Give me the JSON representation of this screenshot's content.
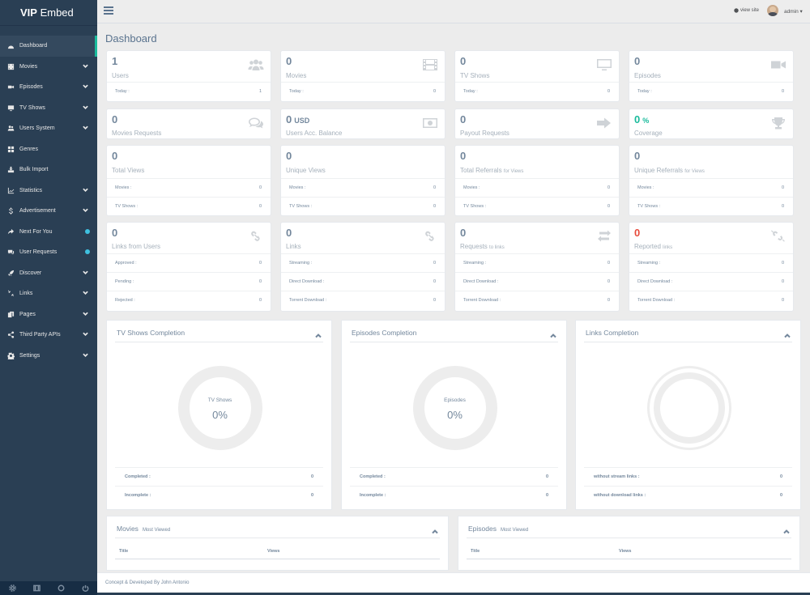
{
  "brand": {
    "bold": "VIP",
    "rest": " Embed"
  },
  "topbar": {
    "view_site": "view site",
    "user": "admin"
  },
  "sidebar": {
    "items": [
      {
        "label": "Dashboard",
        "icon": "dashboard-icon",
        "chevron": false,
        "badge": false,
        "active": true
      },
      {
        "label": "Movies",
        "icon": "film-icon",
        "chevron": true,
        "badge": false
      },
      {
        "label": "Episodes",
        "icon": "video-camera-icon",
        "chevron": true,
        "badge": false
      },
      {
        "label": "TV Shows",
        "icon": "tv-icon",
        "chevron": true,
        "badge": false
      },
      {
        "label": "Users System",
        "icon": "users-icon",
        "chevron": true,
        "badge": false
      },
      {
        "label": "Genres",
        "icon": "grid-icon",
        "chevron": false,
        "badge": false
      },
      {
        "label": "Bulk Import",
        "icon": "import-icon",
        "chevron": false,
        "badge": false
      },
      {
        "label": "Statistics",
        "icon": "line-chart-icon",
        "chevron": true,
        "badge": false
      },
      {
        "label": "Advertisement",
        "icon": "dollar-icon",
        "chevron": true,
        "badge": false
      },
      {
        "label": "Next For You",
        "icon": "share-icon",
        "chevron": false,
        "badge": true
      },
      {
        "label": "User Requests",
        "icon": "comments-icon",
        "chevron": false,
        "badge": true
      },
      {
        "label": "Discover",
        "icon": "rocket-icon",
        "chevron": true,
        "badge": false
      },
      {
        "label": "Links",
        "icon": "unlink-icon",
        "chevron": true,
        "badge": false
      },
      {
        "label": "Pages",
        "icon": "pages-icon",
        "chevron": true,
        "badge": false
      },
      {
        "label": "Third Party APIs",
        "icon": "share-alt-icon",
        "chevron": true,
        "badge": false
      },
      {
        "label": "Settings",
        "icon": "cog-icon",
        "chevron": true,
        "badge": false
      }
    ]
  },
  "page_title": "Dashboard",
  "stats_row1": [
    {
      "value": "1",
      "label": "Users",
      "icon": "users-icon",
      "today_label": "Today :",
      "today_value": "1"
    },
    {
      "value": "0",
      "label": "Movies",
      "icon": "film-icon",
      "today_label": "Today :",
      "today_value": "0"
    },
    {
      "value": "0",
      "label": "TV Shows",
      "icon": "tv-icon",
      "today_label": "Today :",
      "today_value": "0"
    },
    {
      "value": "0",
      "label": "Episodes",
      "icon": "video-camera-icon",
      "today_label": "Today :",
      "today_value": "0"
    }
  ],
  "stats_row2": [
    {
      "value": "0",
      "unit": "",
      "label": "Movies Requests",
      "icon": "comments-icon",
      "color": "#73879c"
    },
    {
      "value": "0",
      "unit": "USD",
      "label": "Users Acc. Balance",
      "icon": "money-icon",
      "color": "#73879c"
    },
    {
      "value": "0",
      "unit": "",
      "label": "Payout Requests",
      "icon": "sign-out-icon",
      "color": "#73879c"
    },
    {
      "value": "0",
      "unit": "%",
      "label": "Coverage",
      "icon": "trophy-icon",
      "color": "#1abb9c"
    }
  ],
  "stats_row3": [
    {
      "value": "0",
      "label": "Total Views",
      "sub": "",
      "rows": [
        {
          "k": "Movies :",
          "v": "0"
        },
        {
          "k": "TV Shows :",
          "v": "0"
        }
      ]
    },
    {
      "value": "0",
      "label": "Unique Views",
      "sub": "",
      "rows": [
        {
          "k": "Movies :",
          "v": "0"
        },
        {
          "k": "TV Shows :",
          "v": "0"
        }
      ]
    },
    {
      "value": "0",
      "label": "Total Referrals",
      "sub": "for Views",
      "rows": [
        {
          "k": "Movies :",
          "v": "0"
        },
        {
          "k": "TV Shows :",
          "v": "0"
        }
      ]
    },
    {
      "value": "0",
      "label": "Unique Referrals",
      "sub": "for Views",
      "rows": [
        {
          "k": "Movies :",
          "v": "0"
        },
        {
          "k": "TV Shows :",
          "v": "0"
        }
      ]
    }
  ],
  "stats_row4": [
    {
      "value": "0",
      "label": "Links from Users",
      "sub": "",
      "icon": "link-icon",
      "color": "#73879c",
      "rows": [
        {
          "k": "Approved :",
          "v": "0"
        },
        {
          "k": "Pending :",
          "v": "0"
        },
        {
          "k": "Rejected :",
          "v": "0"
        }
      ]
    },
    {
      "value": "0",
      "label": "Links",
      "sub": "",
      "icon": "link-icon",
      "color": "#73879c",
      "rows": [
        {
          "k": "Streaming :",
          "v": "0"
        },
        {
          "k": "Direct Download :",
          "v": "0"
        },
        {
          "k": "Torrent Download :",
          "v": "0"
        }
      ]
    },
    {
      "value": "0",
      "label": "Requests",
      "sub": "to links",
      "icon": "exchange-icon",
      "color": "#73879c",
      "rows": [
        {
          "k": "Streaming :",
          "v": "0"
        },
        {
          "k": "Direct Download :",
          "v": "0"
        },
        {
          "k": "Torrent Download :",
          "v": "0"
        }
      ]
    },
    {
      "value": "0",
      "label": "Reported",
      "sub": "links",
      "icon": "unlink-icon",
      "color": "#e74c3c",
      "rows": [
        {
          "k": "Streaming :",
          "v": "0"
        },
        {
          "k": "Direct Download :",
          "v": "0"
        },
        {
          "k": "Torrent Download :",
          "v": "0"
        }
      ]
    }
  ],
  "completion_panels": [
    {
      "title": "TV Shows Completion",
      "donut_label": "TV Shows",
      "donut_value": "0%",
      "percent": 0,
      "rows": [
        {
          "k": "Completed :",
          "v": "0"
        },
        {
          "k": "Incomplete :",
          "v": "0"
        }
      ]
    },
    {
      "title": "Episodes Completion",
      "donut_label": "Episodes",
      "donut_value": "0%",
      "percent": 0,
      "rows": [
        {
          "k": "Completed :",
          "v": "0"
        },
        {
          "k": "Incomplete :",
          "v": "0"
        }
      ]
    },
    {
      "title": "Links Completion",
      "donut_label": "",
      "donut_value": "",
      "percent": 0,
      "rows": [
        {
          "k": "without stream links :",
          "v": "0"
        },
        {
          "k": "without download links :",
          "v": "0"
        }
      ]
    }
  ],
  "most_viewed": [
    {
      "title": "Movies",
      "sub": "Most Viewed",
      "col1": "Title",
      "col2": "Views"
    },
    {
      "title": "Episodes",
      "sub": "Most Viewed",
      "col1": "Title",
      "col2": "Views"
    }
  ],
  "footer": "Concept & Developed By John Antonio"
}
